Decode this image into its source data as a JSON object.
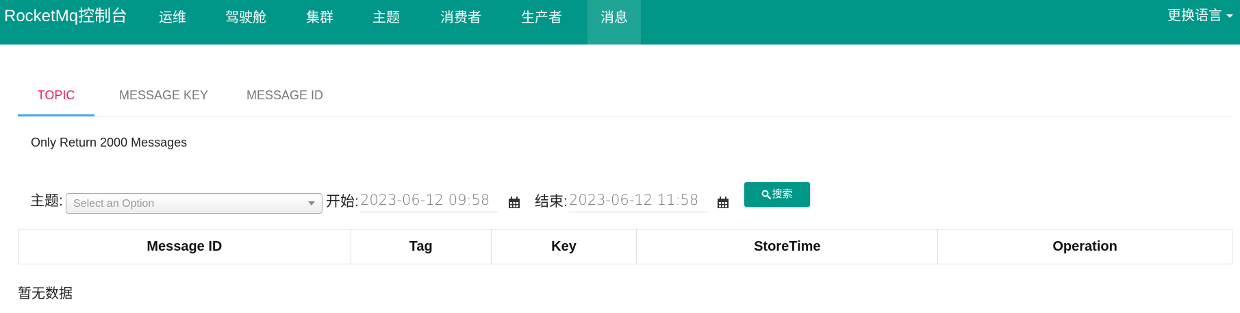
{
  "navbar": {
    "brand": "RocketMq控制台",
    "items": [
      {
        "label": "运维"
      },
      {
        "label": "驾驶舱"
      },
      {
        "label": "集群"
      },
      {
        "label": "主题"
      },
      {
        "label": "消费者"
      },
      {
        "label": "生产者"
      },
      {
        "label": "消息",
        "active": true
      }
    ],
    "language_label": "更换语言",
    "bg_color": "#009688"
  },
  "tabs": [
    {
      "label": "TOPIC",
      "active": true
    },
    {
      "label": "MESSAGE KEY"
    },
    {
      "label": "MESSAGE ID"
    }
  ],
  "info_text": "Only Return 2000 Messages",
  "filters": {
    "topic_label": "主题:",
    "topic_placeholder": "Select an Option",
    "start_label": "开始:",
    "start_value": "2023-06-12 09:58",
    "end_label": "结束:",
    "end_value": "2023-06-12 11:58",
    "search_label": "搜索"
  },
  "table": {
    "columns": [
      "Message ID",
      "Tag",
      "Key",
      "StoreTime",
      "Operation"
    ],
    "rows": []
  },
  "empty_text": "暂无数据",
  "colors": {
    "accent": "#009688",
    "active_tab_text": "#e91e63",
    "active_tab_underline": "#42a5f5"
  },
  "icons": [
    "calendar-icon",
    "search-icon",
    "caret-down-icon",
    "dropdown-arrow-icon"
  ]
}
